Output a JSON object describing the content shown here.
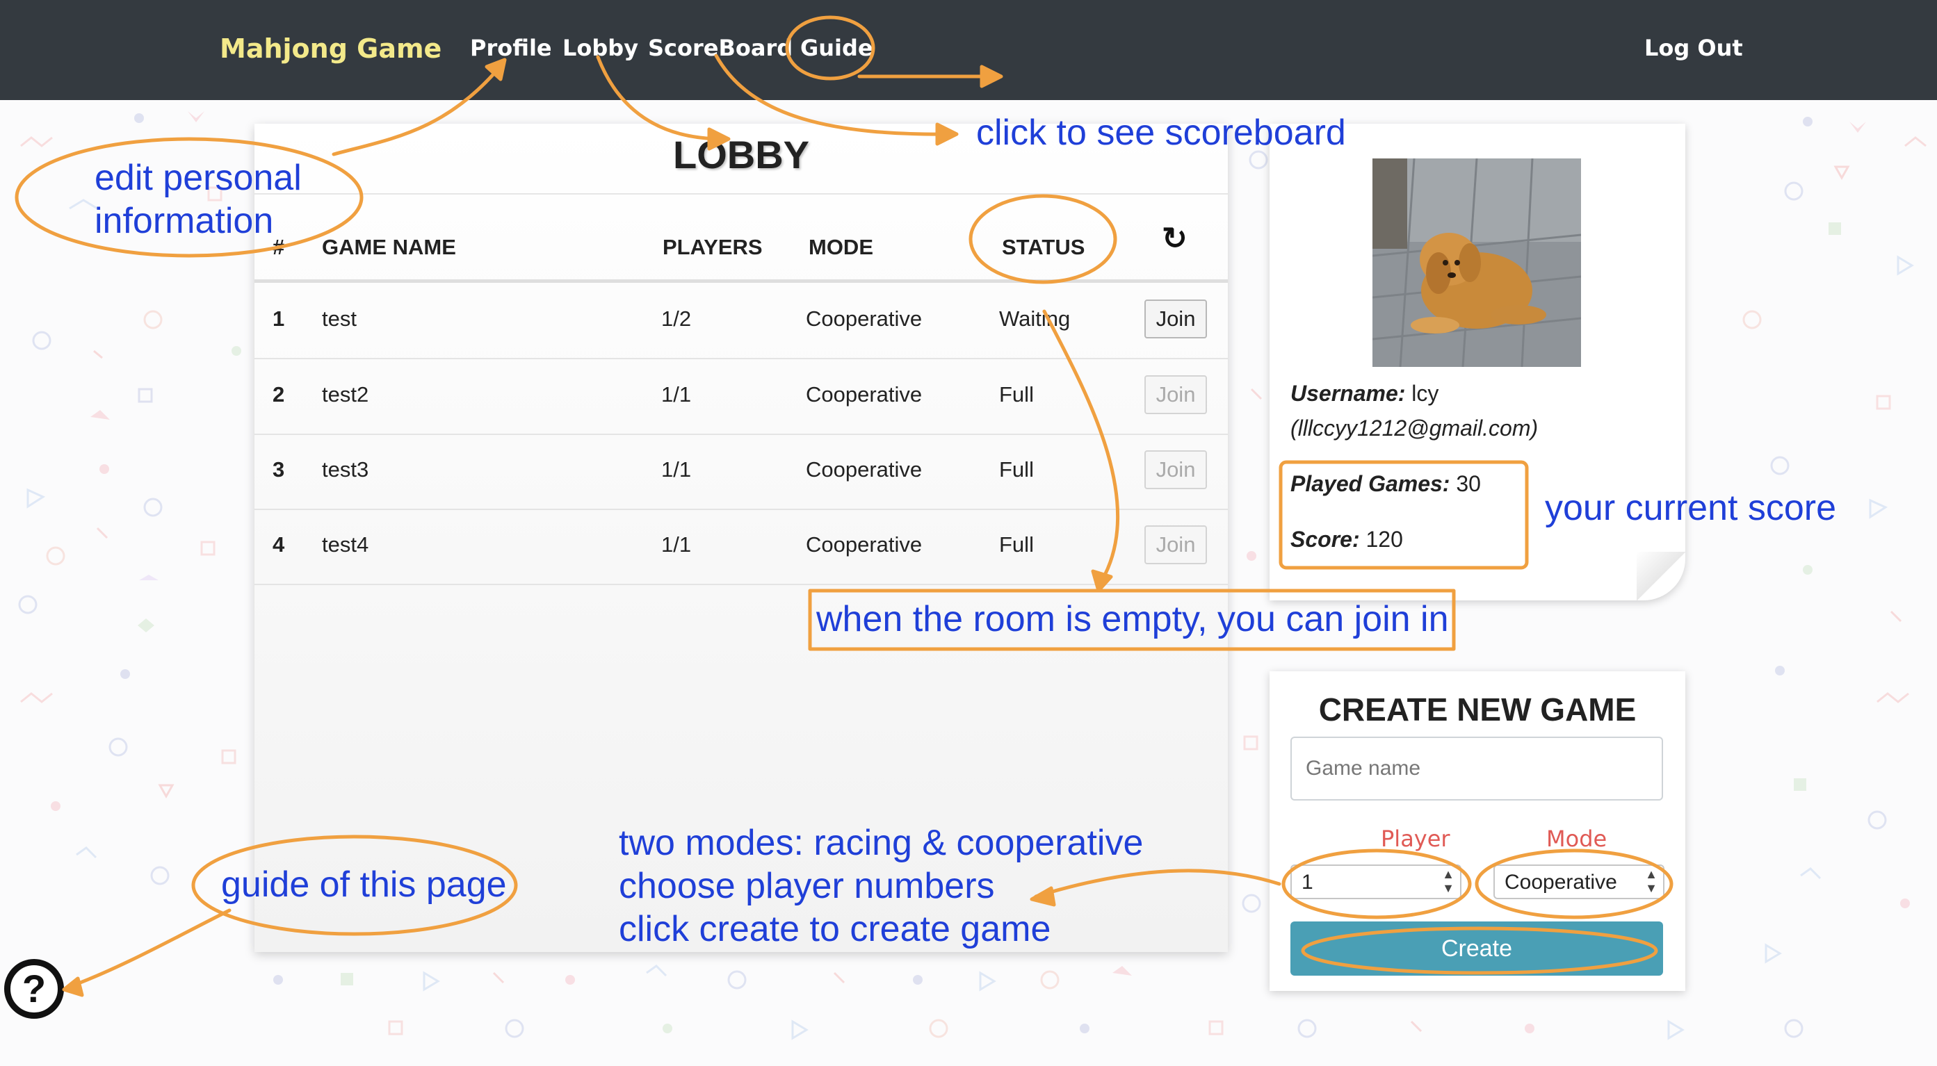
{
  "navbar": {
    "brand": "Mahjong Game",
    "links": {
      "profile": "Profile",
      "lobby": "Lobby",
      "scoreboard": "ScoreBoard",
      "guide": "Guide"
    },
    "logout": "Log Out"
  },
  "lobby": {
    "title": "LOBBY",
    "headers": {
      "num": "#",
      "game_name": "GAME NAME",
      "players": "PLAYERS",
      "mode": "MODE",
      "status": "STATUS"
    },
    "refresh_icon": "refresh-icon",
    "rows": [
      {
        "num": "1",
        "name": "test",
        "players": "1/2",
        "mode": "Cooperative",
        "status": "Waiting",
        "action": "Join",
        "enabled": true
      },
      {
        "num": "2",
        "name": "test2",
        "players": "1/1",
        "mode": "Cooperative",
        "status": "Full",
        "action": "Join",
        "enabled": false
      },
      {
        "num": "3",
        "name": "test3",
        "players": "1/1",
        "mode": "Cooperative",
        "status": "Full",
        "action": "Join",
        "enabled": false
      },
      {
        "num": "4",
        "name": "test4",
        "players": "1/1",
        "mode": "Cooperative",
        "status": "Full",
        "action": "Join",
        "enabled": false
      }
    ]
  },
  "profile": {
    "username_label": "Username:",
    "username": "lcy",
    "email": "(lllccyy1212@gmail.com)",
    "played_label": "Played Games:",
    "played": "30",
    "score_label": "Score:",
    "score": "120"
  },
  "create": {
    "title": "CREATE NEW GAME",
    "placeholder": "Game name",
    "player_label": "Player",
    "mode_label": "Mode",
    "player_value": "1",
    "mode_value": "Cooperative",
    "button": "Create"
  },
  "help_icon": "question-mark-icon",
  "annotations": {
    "edit_profile": [
      "edit personal",
      "information"
    ],
    "scoreboard": "click to see scoreboard",
    "current_score": "your current score",
    "join": "when the room is empty, you can join in",
    "guide": "guide of this page",
    "modes": [
      "two modes: racing & cooperative",
      "choose player numbers",
      "click create to create game"
    ]
  },
  "colors": {
    "navbar": "#343a40",
    "brand": "#f3e98a",
    "annotation_text": "#1f3fd8",
    "annotation_stroke": "#f0a040",
    "create_button": "#4a9fb5",
    "form_label": "#e05a55"
  }
}
